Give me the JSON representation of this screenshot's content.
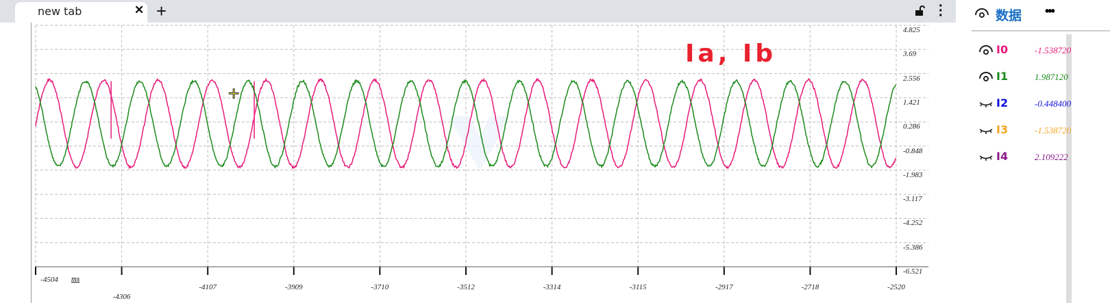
{
  "browser": {
    "tab_title": "new tab",
    "close_icon": "close-icon",
    "new_tab_icon": "plus-icon",
    "lock_icon": "unlock-icon",
    "menu_icon": "kebab-icon"
  },
  "panel": {
    "title": "数据",
    "more": "•••",
    "items": [
      {
        "name": "I0",
        "value": "-1.538720",
        "color": "#e8197a",
        "visible": true
      },
      {
        "name": "I1",
        "value": "1.987120",
        "color": "#1a8a1a",
        "visible": true
      },
      {
        "name": "I2",
        "value": "-0.448400",
        "color": "#1111dd",
        "visible": false
      },
      {
        "name": "I3",
        "value": "-1.538720",
        "color": "#f5a623",
        "visible": false
      },
      {
        "name": "I4",
        "value": "2.109222",
        "color": "#8b1a8b",
        "visible": false
      }
    ]
  },
  "chart_data": {
    "type": "line",
    "title": "Ia, Ib",
    "xlabel": "ms",
    "xlim": [
      -4504,
      -2520
    ],
    "ylim": [
      -6.521,
      4.825
    ],
    "x_ticks": [
      "-4504",
      "-4306",
      "-4107",
      "-3909",
      "-3710",
      "-3512",
      "-3314",
      "-3115",
      "-2917",
      "-2718",
      "-2520"
    ],
    "y_ticks": [
      "4.825",
      "3.69",
      "2.556",
      "1.421",
      "0.286",
      "-0.848",
      "-1.983",
      "-3.117",
      "-4.252",
      "-5.386",
      "-6.521"
    ],
    "grid": true,
    "series": [
      {
        "name": "I0",
        "color": "#e8197a",
        "amplitude": 2.05,
        "offset": 0.2,
        "period_ms": 125,
        "peak_at_ms": -4472,
        "glitches_ms": [
          -4330,
          -4000
        ]
      },
      {
        "name": "I1",
        "color": "#1a8a1a",
        "amplitude": 2.0,
        "offset": 0.2,
        "period_ms": 125,
        "peak_at_ms": -4389,
        "glitches_ms": []
      }
    ]
  }
}
